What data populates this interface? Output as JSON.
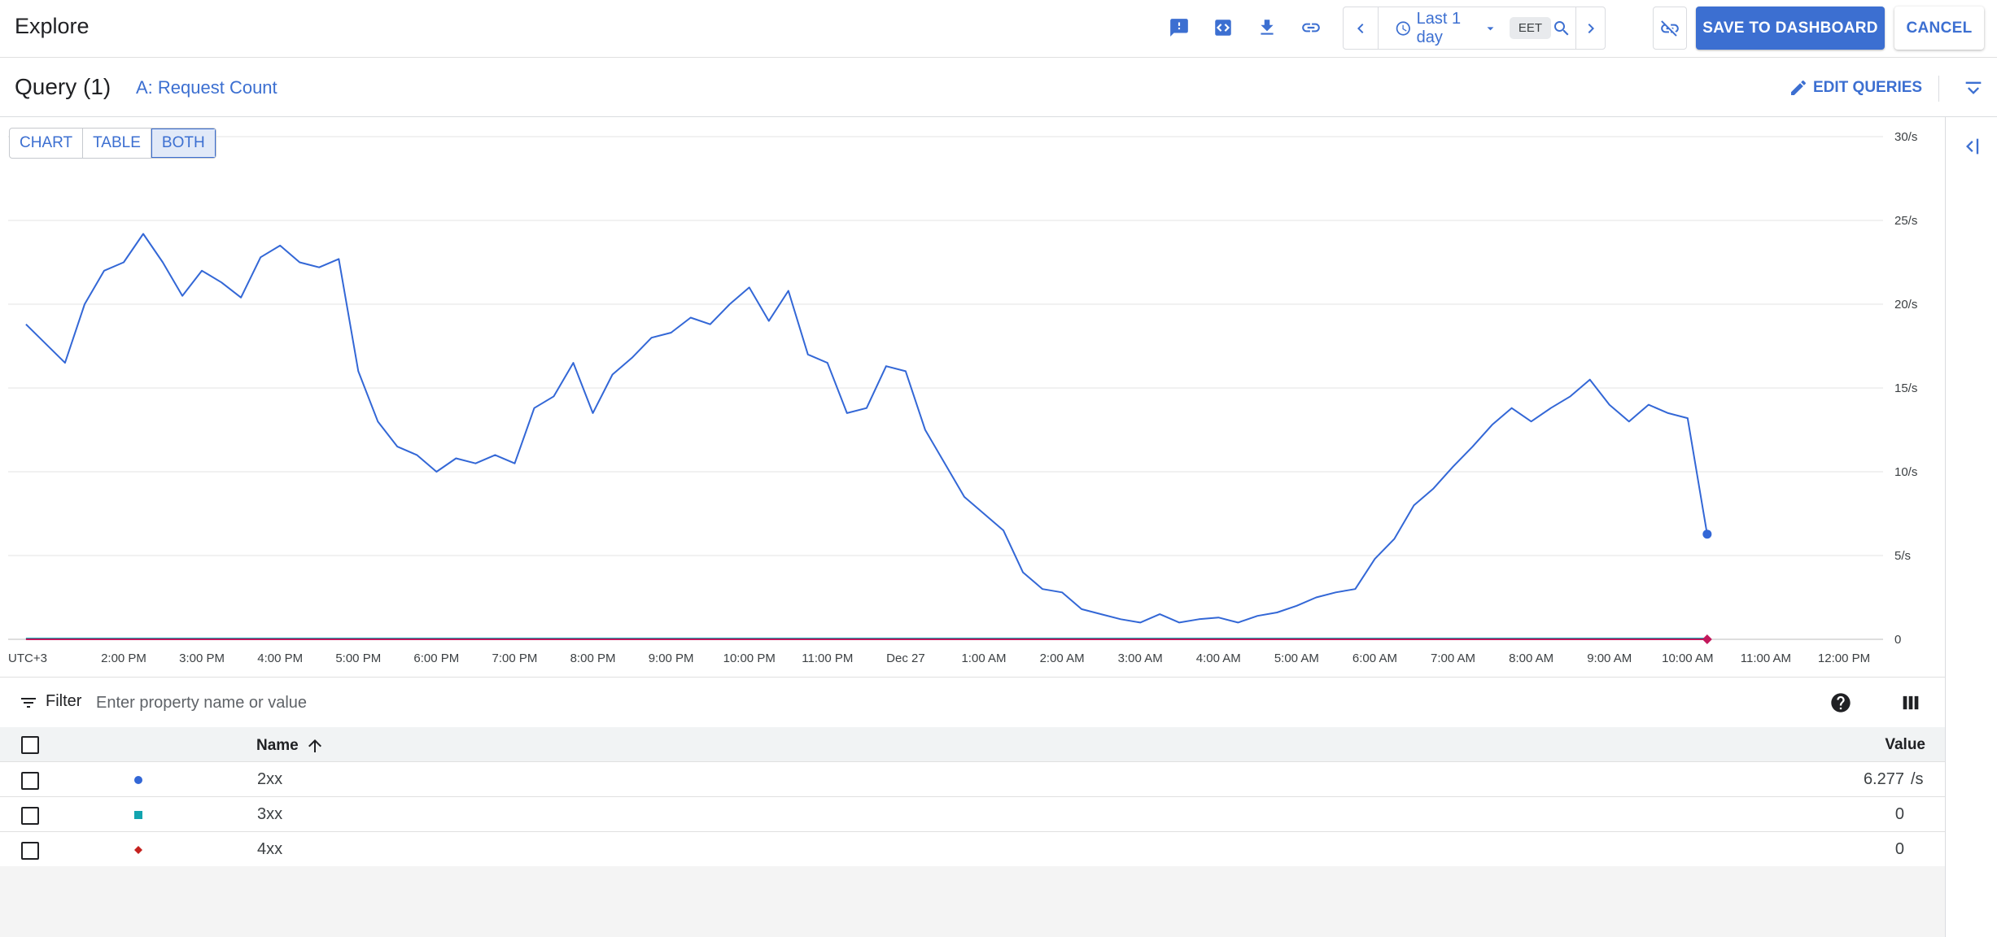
{
  "app": {
    "title": "Explore"
  },
  "toolbar": {
    "icons": [
      "feedback-icon",
      "code-icon",
      "download-icon",
      "link-icon"
    ],
    "time_range": "Last 1 day",
    "timezone": "EET",
    "save_label": "SAVE TO DASHBOARD",
    "cancel_label": "CANCEL"
  },
  "query": {
    "title": "Query (1)",
    "name": "A: Request Count",
    "edit_label": "EDIT QUERIES"
  },
  "view_toggle": {
    "chart": "CHART",
    "table": "TABLE",
    "both": "BOTH",
    "active": "both"
  },
  "chart_data": {
    "type": "line",
    "timezone_label": "UTC+3",
    "x_tick_labels": [
      "2:00 PM",
      "3:00 PM",
      "4:00 PM",
      "5:00 PM",
      "6:00 PM",
      "7:00 PM",
      "8:00 PM",
      "9:00 PM",
      "10:00 PM",
      "11:00 PM",
      "Dec 27",
      "1:00 AM",
      "2:00 AM",
      "3:00 AM",
      "4:00 AM",
      "5:00 AM",
      "6:00 AM",
      "7:00 AM",
      "8:00 AM",
      "9:00 AM",
      "10:00 AM",
      "11:00 AM",
      "12:00 PM"
    ],
    "y_tick_labels": [
      "0",
      "5/s",
      "10/s",
      "15/s",
      "20/s",
      "25/s",
      "30/s"
    ],
    "ylim": [
      0,
      30
    ],
    "y_unit": "/s",
    "grid": true,
    "series": [
      {
        "name": "2xx",
        "color": "#3367d6",
        "marker": "circle",
        "time_hours": [
          12.75,
          13.25,
          13.5,
          13.75,
          14.0,
          14.25,
          14.5,
          14.75,
          15.0,
          15.25,
          15.5,
          15.75,
          16.0,
          16.25,
          16.5,
          16.75,
          17.0,
          17.25,
          17.5,
          17.75,
          18.0,
          18.25,
          18.5,
          18.75,
          19.0,
          19.25,
          19.5,
          19.75,
          20.0,
          20.25,
          20.5,
          20.75,
          21.0,
          21.25,
          21.5,
          21.75,
          22.0,
          22.25,
          22.5,
          22.75,
          23.0,
          23.25,
          23.5,
          23.75,
          24.0,
          24.25,
          24.5,
          24.75,
          25.0,
          25.25,
          25.5,
          25.75,
          26.0,
          26.25,
          26.5,
          26.75,
          27.0,
          27.25,
          27.5,
          27.75,
          28.0,
          28.25,
          28.5,
          28.75,
          29.0,
          29.25,
          29.5,
          29.75,
          30.0,
          30.25,
          30.5,
          30.75,
          31.0,
          31.25,
          31.5,
          31.75,
          32.0,
          32.25,
          32.5,
          32.75,
          33.0,
          33.25,
          33.5,
          33.75,
          34.0,
          34.25,
          34.5,
          34.75,
          35.0,
          35.25,
          35.5,
          35.75,
          36.0,
          36.25,
          36.5,
          36.75,
          37.0
        ],
        "values": [
          18.8,
          16.5,
          20.0,
          22.0,
          22.5,
          24.2,
          22.5,
          20.5,
          22.0,
          21.3,
          20.4,
          22.8,
          23.5,
          22.5,
          22.2,
          22.7,
          16.0,
          13.0,
          11.5,
          11.0,
          10.0,
          10.8,
          10.5,
          11.0,
          10.5,
          13.8,
          14.5,
          16.5,
          13.5,
          15.8,
          16.8,
          18.0,
          18.3,
          19.2,
          18.8,
          20.0,
          21.0,
          19.0,
          20.8,
          17.0,
          16.5,
          13.5,
          13.8,
          16.3,
          16.0,
          12.5,
          10.5,
          8.5,
          7.5,
          6.5,
          4.0,
          3.0,
          2.8,
          1.8,
          1.5,
          1.2,
          1.0,
          1.5,
          1.0,
          1.2,
          1.3,
          1.0,
          1.4,
          1.6,
          2.0,
          2.5,
          2.8,
          3.0,
          4.8,
          6.0,
          8.0,
          9.0,
          10.3,
          11.5,
          12.8,
          13.8,
          13.0,
          13.8,
          14.5,
          15.5,
          14.0,
          13.0,
          14.0,
          13.5,
          13.2,
          6.277
        ],
        "last_value": "6.277"
      },
      {
        "name": "3xx",
        "color": "#12a4af",
        "marker": "square",
        "values": [
          0
        ],
        "last_value": "0"
      },
      {
        "name": "4xx",
        "color": "#c5221f",
        "marker": "diamond",
        "values": [
          0
        ],
        "last_value": "0"
      }
    ]
  },
  "filter": {
    "label": "Filter",
    "placeholder": "Enter property name or value"
  },
  "table": {
    "headers": {
      "name": "Name",
      "value": "Value"
    },
    "rows": [
      {
        "name": "2xx",
        "value": "6.277",
        "unit": "/s",
        "color": "#3367d6",
        "marker": "circle"
      },
      {
        "name": "3xx",
        "value": "0",
        "unit": "",
        "color": "#12a4af",
        "marker": "square"
      },
      {
        "name": "4xx",
        "value": "0",
        "unit": "",
        "color": "#c5221f",
        "marker": "diamond"
      }
    ]
  }
}
